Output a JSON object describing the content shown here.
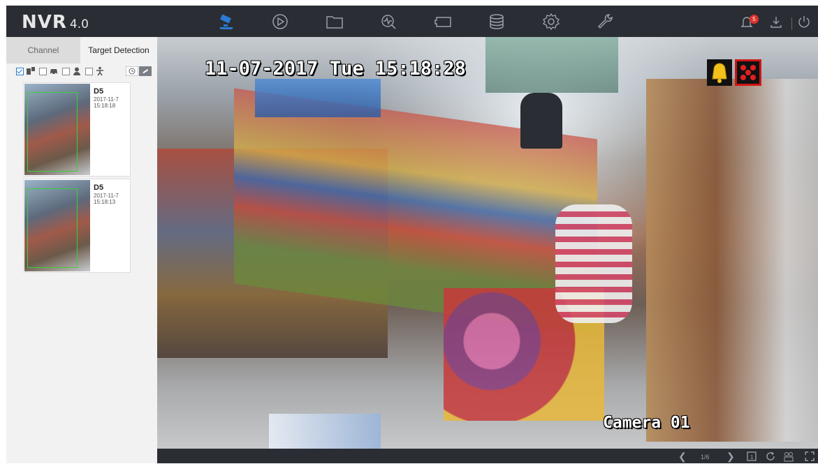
{
  "header": {
    "logo": "NVR",
    "version": "4.0",
    "nav": [
      {
        "icon": "live-view-camera-icon",
        "active": true
      },
      {
        "icon": "playback-icon"
      },
      {
        "icon": "file-management-icon"
      },
      {
        "icon": "smart-analysis-icon"
      },
      {
        "icon": "configuration-icon"
      },
      {
        "icon": "storage-icon"
      },
      {
        "icon": "system-settings-icon"
      },
      {
        "icon": "maintenance-icon"
      }
    ],
    "notification_count": "5",
    "accent_color": "#2a7bd4"
  },
  "sidebar": {
    "tabs": [
      {
        "label": "Channel",
        "active": false
      },
      {
        "label": "Target Detection",
        "active": true
      }
    ],
    "filters": [
      {
        "icon": "all-targets-icon",
        "checked": true
      },
      {
        "icon": "vehicle-icon",
        "checked": false
      },
      {
        "icon": "person-face-icon",
        "checked": false
      },
      {
        "icon": "human-body-icon",
        "checked": false
      }
    ],
    "events": [
      {
        "channel": "D5",
        "date": "2017-11-7",
        "time": "15:18:18"
      },
      {
        "channel": "D5",
        "date": "2017-11-7",
        "time": "15:18:13"
      }
    ]
  },
  "video": {
    "datetime": "11-07-2017 Tue 15:18:28",
    "camera_name": "Camera 01",
    "alarm_icons": [
      "alarm-bell-icon",
      "motion-detection-icon"
    ]
  },
  "bottombar": {
    "page_indicator": "1/6"
  }
}
